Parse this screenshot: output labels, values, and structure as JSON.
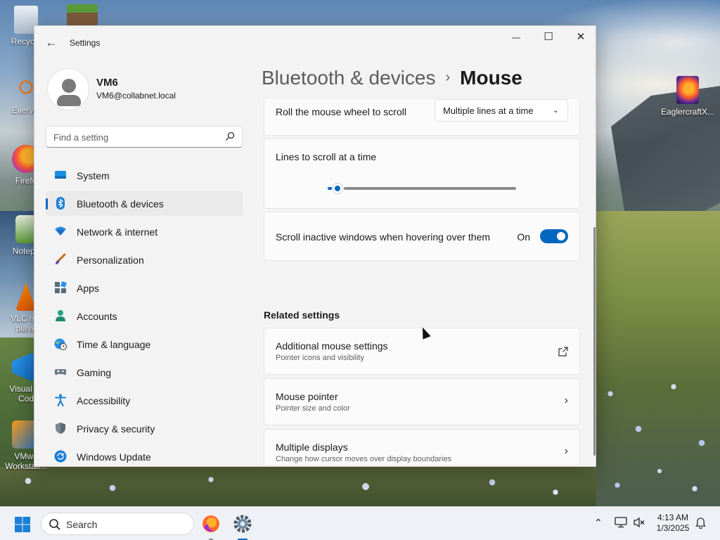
{
  "desktop": {
    "icons": [
      {
        "label": "Recycle"
      },
      {
        "label": "Everyth"
      },
      {
        "label": "Firefo"
      },
      {
        "label": "Notepa"
      },
      {
        "label": "VLC me"
      },
      {
        "label": "playe"
      },
      {
        "label": "Visual St"
      },
      {
        "label": "Cod"
      },
      {
        "label": "VMwa"
      },
      {
        "label": "Workstati..."
      },
      {
        "label": "EaglercraftX..."
      }
    ]
  },
  "window": {
    "app_title": "Settings",
    "controls": {
      "minimize": "—",
      "maximize": "☐",
      "close": "✕"
    }
  },
  "profile": {
    "name": "VM6",
    "email": "VM6@collabnet.local"
  },
  "search": {
    "placeholder": "Find a setting"
  },
  "nav": {
    "items": [
      {
        "label": "System",
        "icon": "monitor-icon"
      },
      {
        "label": "Bluetooth & devices",
        "icon": "bluetooth-icon",
        "selected": true
      },
      {
        "label": "Network & internet",
        "icon": "wifi-icon"
      },
      {
        "label": "Personalization",
        "icon": "brush-icon"
      },
      {
        "label": "Apps",
        "icon": "apps-icon"
      },
      {
        "label": "Accounts",
        "icon": "person-icon"
      },
      {
        "label": "Time & language",
        "icon": "globe-clock-icon"
      },
      {
        "label": "Gaming",
        "icon": "gamepad-icon"
      },
      {
        "label": "Accessibility",
        "icon": "accessibility-icon"
      },
      {
        "label": "Privacy & security",
        "icon": "shield-icon"
      },
      {
        "label": "Windows Update",
        "icon": "update-icon"
      }
    ]
  },
  "breadcrumb": {
    "parent": "Bluetooth & devices",
    "separator": "›",
    "current": "Mouse"
  },
  "settings": {
    "roll_wheel": {
      "label": "Roll the mouse wheel to scroll",
      "value": "Multiple lines at a time"
    },
    "lines_to_scroll": {
      "label": "Lines to scroll at a time",
      "level": 0.0
    },
    "scroll_inactive": {
      "label": "Scroll inactive windows when hovering over them",
      "state": "On"
    },
    "related_header": "Related settings",
    "related": [
      {
        "title": "Additional mouse settings",
        "subtitle": "Pointer icons and visibility",
        "icon": "external-link-icon"
      },
      {
        "title": "Mouse pointer",
        "subtitle": "Pointer size and color",
        "icon": "chevron-right-icon"
      },
      {
        "title": "Multiple displays",
        "subtitle": "Change how cursor moves over display boundaries",
        "icon": "chevron-right-icon"
      }
    ]
  },
  "taskbar": {
    "search_label": "Search",
    "time": "4:13 AM",
    "date": "1/3/2025"
  },
  "colors": {
    "accent": "#0067c0",
    "window_bg": "#f3f3f3",
    "card_bg": "#fbfbfb"
  }
}
